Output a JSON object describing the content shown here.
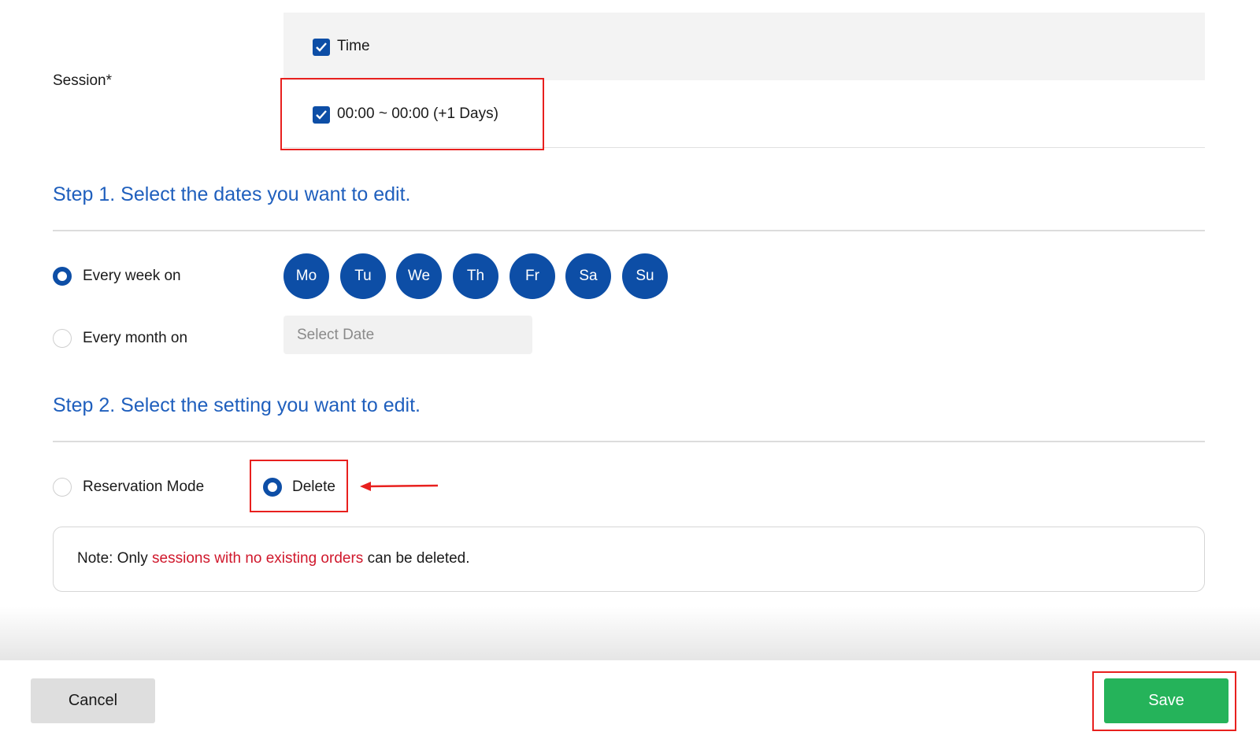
{
  "session": {
    "label": "Session*",
    "header_checkbox_label": "Time",
    "rows": [
      {
        "label": "00:00 ~ 00:00 (+1 Days)",
        "checked": true
      }
    ]
  },
  "step1": {
    "title": "Step 1. Select the dates you want to edit.",
    "options": [
      {
        "label": "Every week on",
        "selected": true
      },
      {
        "label": "Every month on",
        "selected": false
      }
    ],
    "days": [
      "Mo",
      "Tu",
      "We",
      "Th",
      "Fr",
      "Sa",
      "Su"
    ],
    "date_placeholder": "Select Date"
  },
  "step2": {
    "title": "Step 2. Select the setting you want to edit.",
    "options": [
      {
        "label": "Reservation Mode",
        "selected": false
      },
      {
        "label": "Delete",
        "selected": true
      }
    ],
    "note": {
      "prefix": "Note: Only ",
      "highlight": "sessions with no existing orders",
      "suffix": " can be deleted."
    }
  },
  "footer": {
    "cancel_label": "Cancel",
    "save_label": "Save"
  },
  "colors": {
    "accent_blue": "#0d4ea6",
    "heading_blue": "#1f5fbd",
    "highlight_red": "#d0182c",
    "save_green": "#25b35a",
    "annotation_red": "#e8201e"
  }
}
